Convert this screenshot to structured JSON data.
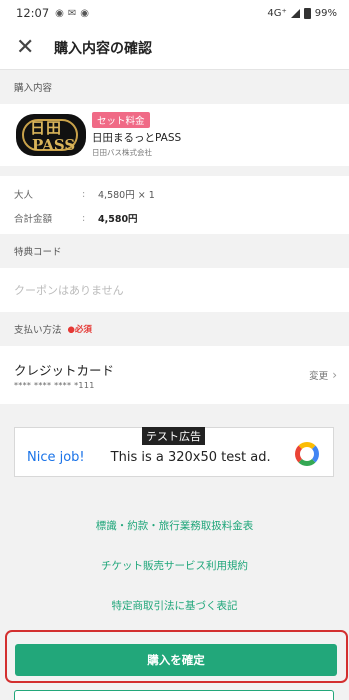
{
  "status_bar": {
    "time": "12:07",
    "network": "4G⁺",
    "battery": "99%"
  },
  "header": {
    "title": "購入内容の確認"
  },
  "purchase": {
    "section_label": "購入内容",
    "badge": "セット料金",
    "product_name": "日田まるっとPASS",
    "company": "日田バス株式会社",
    "logo_top": "日田",
    "logo_bottom": "PASS"
  },
  "price": {
    "rows": [
      {
        "label": "大人",
        "colon": ":",
        "value": "4,580円 × 1"
      },
      {
        "label": "合計金額",
        "colon": ":",
        "value": "4,580円"
      }
    ]
  },
  "coupon": {
    "section_label": "特典コード",
    "text": "クーポンはありません"
  },
  "payment": {
    "section_label": "支払い方法",
    "required": "●必須",
    "method": "クレジットカード",
    "card_number": "**** **** **** *111",
    "change_label": "変更"
  },
  "ad": {
    "label": "テスト広告",
    "nice": "Nice job!",
    "text": "This is a 320x50 test ad."
  },
  "links": [
    "標識・約款・旅行業務取扱料金表",
    "チケット販売サービス利用規約",
    "特定商取引法に基づく表記"
  ],
  "confirm_button": "購入を確定",
  "colors": {
    "accent": "#22a77a",
    "badge": "#f06a86",
    "highlight": "#d32f2f"
  }
}
